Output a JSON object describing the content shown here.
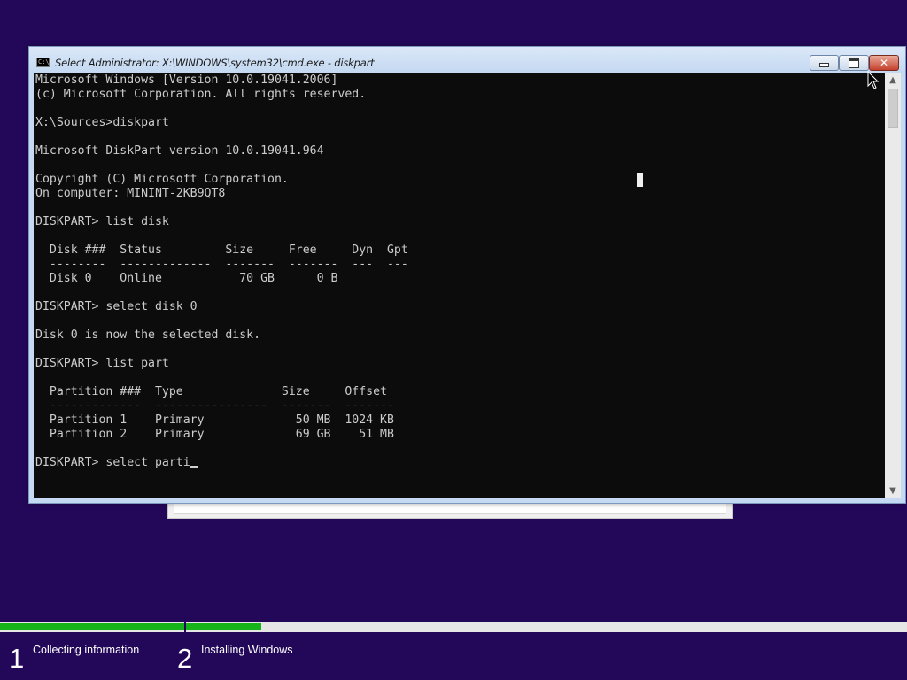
{
  "window": {
    "title": "Select Administrator: X:\\WINDOWS\\system32\\cmd.exe - diskpart",
    "icon_text": "C:\\",
    "minimize_icon": "minimize-icon",
    "maximize_icon": "restore-icon",
    "close_icon": "close-icon",
    "close_glyph": "✕"
  },
  "console": {
    "lines": [
      "Microsoft Windows [Version 10.0.19041.2006]",
      "(c) Microsoft Corporation. All rights reserved.",
      "",
      "X:\\Sources>diskpart",
      "",
      "Microsoft DiskPart version 10.0.19041.964",
      "",
      "Copyright (C) Microsoft Corporation.",
      "On computer: MININT-2KB9QT8",
      "",
      "DISKPART> list disk",
      "",
      "  Disk ###  Status         Size     Free     Dyn  Gpt",
      "  --------  -------------  -------  -------  ---  ---",
      "  Disk 0    Online           70 GB      0 B",
      "",
      "DISKPART> select disk 0",
      "",
      "Disk 0 is now the selected disk.",
      "",
      "DISKPART> list part",
      "",
      "  Partition ###  Type              Size     Offset",
      "  -------------  ----------------  -------  -------",
      "  Partition 1    Primary             50 MB  1024 KB",
      "  Partition 2    Primary             69 GB    51 MB",
      ""
    ],
    "current_input": "DISKPART> select parti",
    "colors": {
      "background": "#0c0c0c",
      "text": "#cccccc"
    }
  },
  "scrollbar": {
    "up_arrow": "▲",
    "down_arrow": "▼"
  },
  "setup": {
    "steps": [
      {
        "number": "1",
        "label": "Collecting information",
        "progress": 1.0
      },
      {
        "number": "2",
        "label": "Installing Windows",
        "progress": 0.105
      }
    ],
    "colors": {
      "background": "#23085a",
      "progress_fill": "#17b31a",
      "progress_track": "#e6e6e6"
    }
  }
}
